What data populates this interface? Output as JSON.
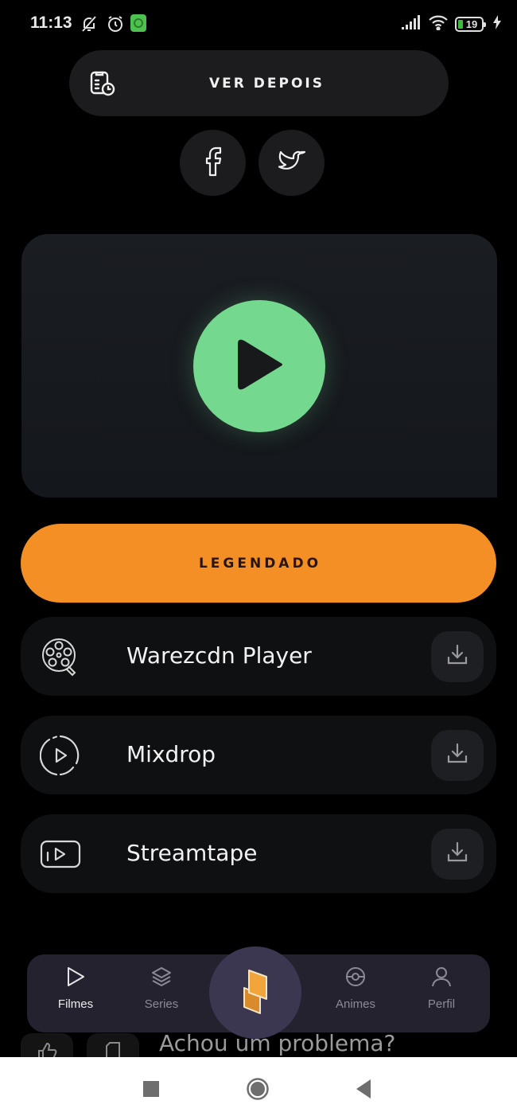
{
  "status_bar": {
    "time": "11:13",
    "left_icons": [
      "notifications-off-icon",
      "alarm-icon",
      "app-notification-icon"
    ],
    "right_icons": [
      "cell-signal-icon",
      "wifi-icon",
      "battery-icon",
      "charging-icon"
    ],
    "battery_level": "19",
    "accent_color": "#3dbb3d"
  },
  "header": {
    "ver_depois_label": "VER DEPOIS",
    "ver_depois_icon": "watch-later-clipboard-icon",
    "social": [
      {
        "name": "facebook",
        "icon": "facebook-icon"
      },
      {
        "name": "twitter",
        "icon": "twitter-icon"
      }
    ]
  },
  "player": {
    "play_icon": "play-icon",
    "play_color": "#74d98e"
  },
  "audio_option": {
    "label": "LEGENDADO",
    "color": "#f48f25"
  },
  "servers": [
    {
      "label": "Warezcdn Player",
      "icon": "film-reel-icon",
      "action_icon": "download-icon"
    },
    {
      "label": "Mixdrop",
      "icon": "play-circle-icon",
      "action_icon": "download-icon"
    },
    {
      "label": "Streamtape",
      "icon": "video-frame-icon",
      "action_icon": "download-icon"
    }
  ],
  "footer_partial": {
    "problem_text": "Achou um problema?",
    "buttons": [
      "like-icon",
      "report-icon"
    ]
  },
  "bottom_nav": {
    "items": [
      {
        "label": "Filmes",
        "icon": "play-outline-icon",
        "active": true
      },
      {
        "label": "Series",
        "icon": "layers-icon",
        "active": false
      },
      {
        "label": "",
        "icon": "app-logo-icon",
        "active": false
      },
      {
        "label": "Animes",
        "icon": "pokeball-icon",
        "active": false
      },
      {
        "label": "Perfil",
        "icon": "user-icon",
        "active": false
      }
    ],
    "center_accent": "#f2a53a"
  },
  "android_nav": {
    "buttons": [
      "recents-button",
      "home-button",
      "back-button"
    ]
  }
}
